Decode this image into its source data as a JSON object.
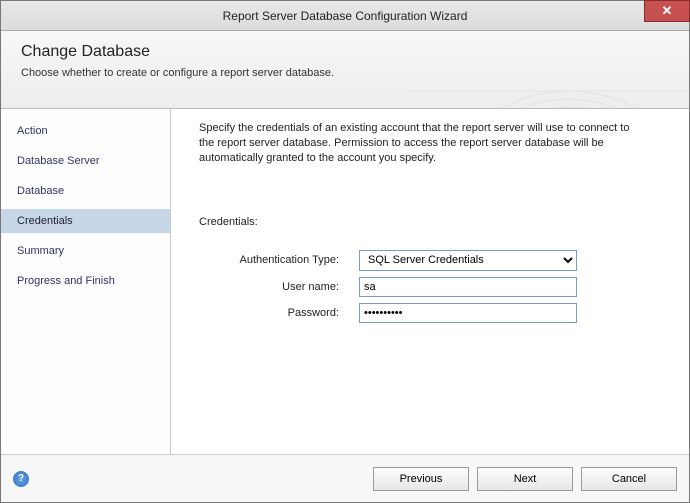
{
  "window": {
    "title": "Report Server Database Configuration Wizard"
  },
  "header": {
    "heading": "Change Database",
    "subtext": "Choose whether to create or configure a report server database."
  },
  "sidebar": {
    "items": [
      {
        "label": "Action"
      },
      {
        "label": "Database Server"
      },
      {
        "label": "Database"
      },
      {
        "label": "Credentials"
      },
      {
        "label": "Summary"
      },
      {
        "label": "Progress and Finish"
      }
    ],
    "active_index": 3
  },
  "content": {
    "instructions": "Specify the credentials of an existing account that the report server will use to connect to the report server database.  Permission to access the report server database will be automatically granted to the account you specify.",
    "credentials_label": "Credentials:",
    "auth_type_label": "Authentication Type:",
    "auth_type_value": "SQL Server Credentials",
    "username_label": "User name:",
    "username_value": "sa",
    "password_label": "Password:",
    "password_value": "••••••••••"
  },
  "footer": {
    "previous": "Previous",
    "next": "Next",
    "cancel": "Cancel"
  }
}
